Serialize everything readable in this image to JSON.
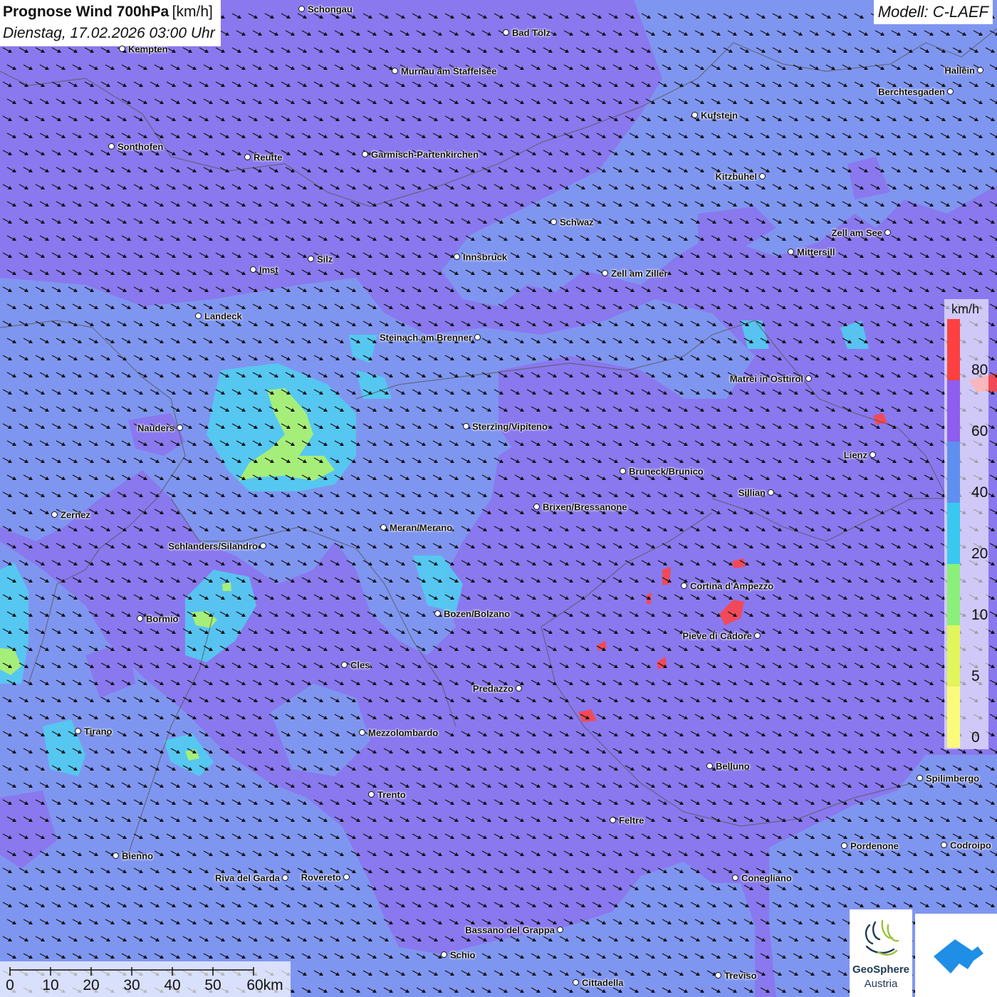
{
  "title": {
    "main": "Prognose Wind 700hPa",
    "unit": "[km/h]",
    "date": "Dienstag, 17.02.2026 03:00 Uhr"
  },
  "model": "Modell: C-LAEF",
  "cities": [
    {
      "name": "Schongau"
    },
    {
      "name": "Bad Tölz"
    },
    {
      "name": "Kempten"
    },
    {
      "name": "Murnau am Staffelsee"
    },
    {
      "name": "Hallein"
    },
    {
      "name": "Berchtesgaden"
    },
    {
      "name": "Kufstein"
    },
    {
      "name": "Sonthofen"
    },
    {
      "name": "Reutte"
    },
    {
      "name": "Garmisch-Partenkirchen"
    },
    {
      "name": "Kitzbühel"
    },
    {
      "name": "Schwaz"
    },
    {
      "name": "Zell am See"
    },
    {
      "name": "Mittersill"
    },
    {
      "name": "Silz"
    },
    {
      "name": "Innsbruck"
    },
    {
      "name": "Imst"
    },
    {
      "name": "Zell am Ziller"
    },
    {
      "name": "Landeck"
    },
    {
      "name": "Steinach am Brenner"
    },
    {
      "name": "Matrei in Osttirol"
    },
    {
      "name": "Nauders"
    },
    {
      "name": "Sterzing/Vipiteno"
    },
    {
      "name": "Lienz"
    },
    {
      "name": "Bruneck/Brunico"
    },
    {
      "name": "Sillian"
    },
    {
      "name": "Brixen/Bressanone"
    },
    {
      "name": "Zernez"
    },
    {
      "name": "Meran/Merano"
    },
    {
      "name": "Schlanders/Silandro"
    },
    {
      "name": "Cortina d'Ampezzo"
    },
    {
      "name": "Bozen/Bolzano"
    },
    {
      "name": "Bormio"
    },
    {
      "name": "Pieve di Cadore"
    },
    {
      "name": "Cles"
    },
    {
      "name": "Predazzo"
    },
    {
      "name": "Tirano"
    },
    {
      "name": "Mezzolombardo"
    },
    {
      "name": "Belluno"
    },
    {
      "name": "Spilimbergo"
    },
    {
      "name": "Trento"
    },
    {
      "name": "Feltre"
    },
    {
      "name": "Bienno"
    },
    {
      "name": "Pordenone"
    },
    {
      "name": "Codroipo"
    },
    {
      "name": "Riva del Garda"
    },
    {
      "name": "Rovereto"
    },
    {
      "name": "Conegliano"
    },
    {
      "name": "Bassano del Grappa"
    },
    {
      "name": "Schio"
    },
    {
      "name": "Treviso"
    },
    {
      "name": "Cittadella"
    }
  ],
  "legend": {
    "unit": "km/h",
    "ticks": [
      "80",
      "60",
      "40",
      "20",
      "10",
      "5",
      "0"
    ],
    "colors": [
      "#ff4040",
      "#8f5df0",
      "#5f8ff0",
      "#38c8f0",
      "#8af07a",
      "#e2f55a",
      "#fbfb7a"
    ]
  },
  "scale": {
    "labels": [
      "0",
      "10",
      "20",
      "30",
      "40",
      "50",
      "60km"
    ]
  },
  "logo": {
    "line1": "GeoSphere",
    "line2": "Austria"
  },
  "colors": {
    "blue_area": "#7f96f0",
    "purple_area": "#8a78ee",
    "cyan": "#4fd0f0",
    "green": "#a6ee7a",
    "red": "#f04a58"
  }
}
